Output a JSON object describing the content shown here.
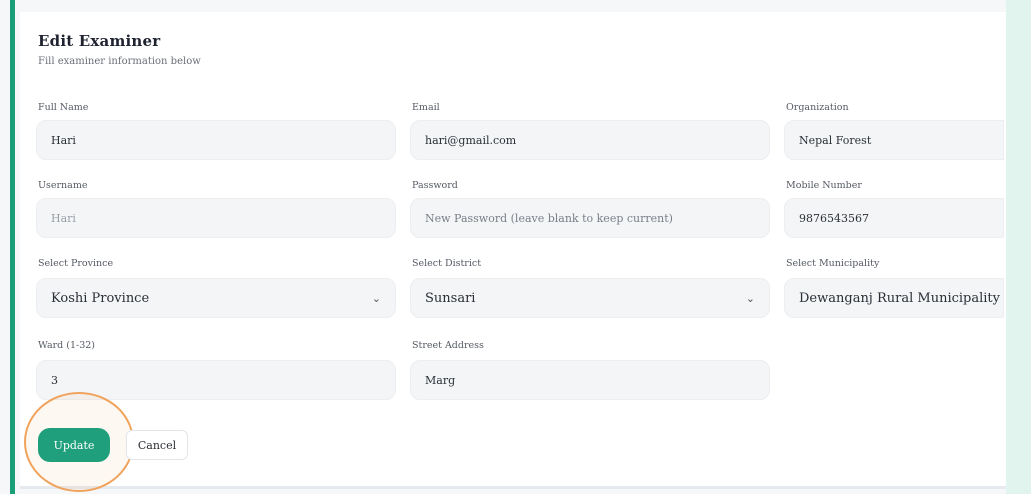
{
  "form": {
    "title": "Edit Examiner",
    "subtitle": "Fill examiner information below",
    "fields": {
      "full_name": {
        "label": "Full Name",
        "value": "Hari"
      },
      "email": {
        "label": "Email",
        "value": "hari@gmail.com"
      },
      "organization": {
        "label": "Organization",
        "value": "Nepal Forest"
      },
      "username": {
        "label": "Username",
        "value": "Hari"
      },
      "password": {
        "label": "Password",
        "placeholder": "New Password (leave blank to keep current)"
      },
      "mobile": {
        "label": "Mobile Number",
        "value": "9876543567"
      },
      "province": {
        "label": "Select Province",
        "value": "Koshi Province"
      },
      "district": {
        "label": "Select District",
        "value": "Sunsari"
      },
      "municipality": {
        "label": "Select Municipality",
        "value": "Dewanganj Rural Municipality"
      },
      "ward": {
        "label": "Ward (1-32)",
        "value": "3"
      },
      "street": {
        "label": "Street Address",
        "value": "Marg"
      }
    },
    "buttons": {
      "update": "Update",
      "cancel": "Cancel"
    }
  },
  "icons": {
    "select_chevron": "chevron-down-icon"
  },
  "colors": {
    "accent": "#1f9f7b",
    "highlight": "#f0a35c",
    "side_bar": "#1a9e78"
  }
}
